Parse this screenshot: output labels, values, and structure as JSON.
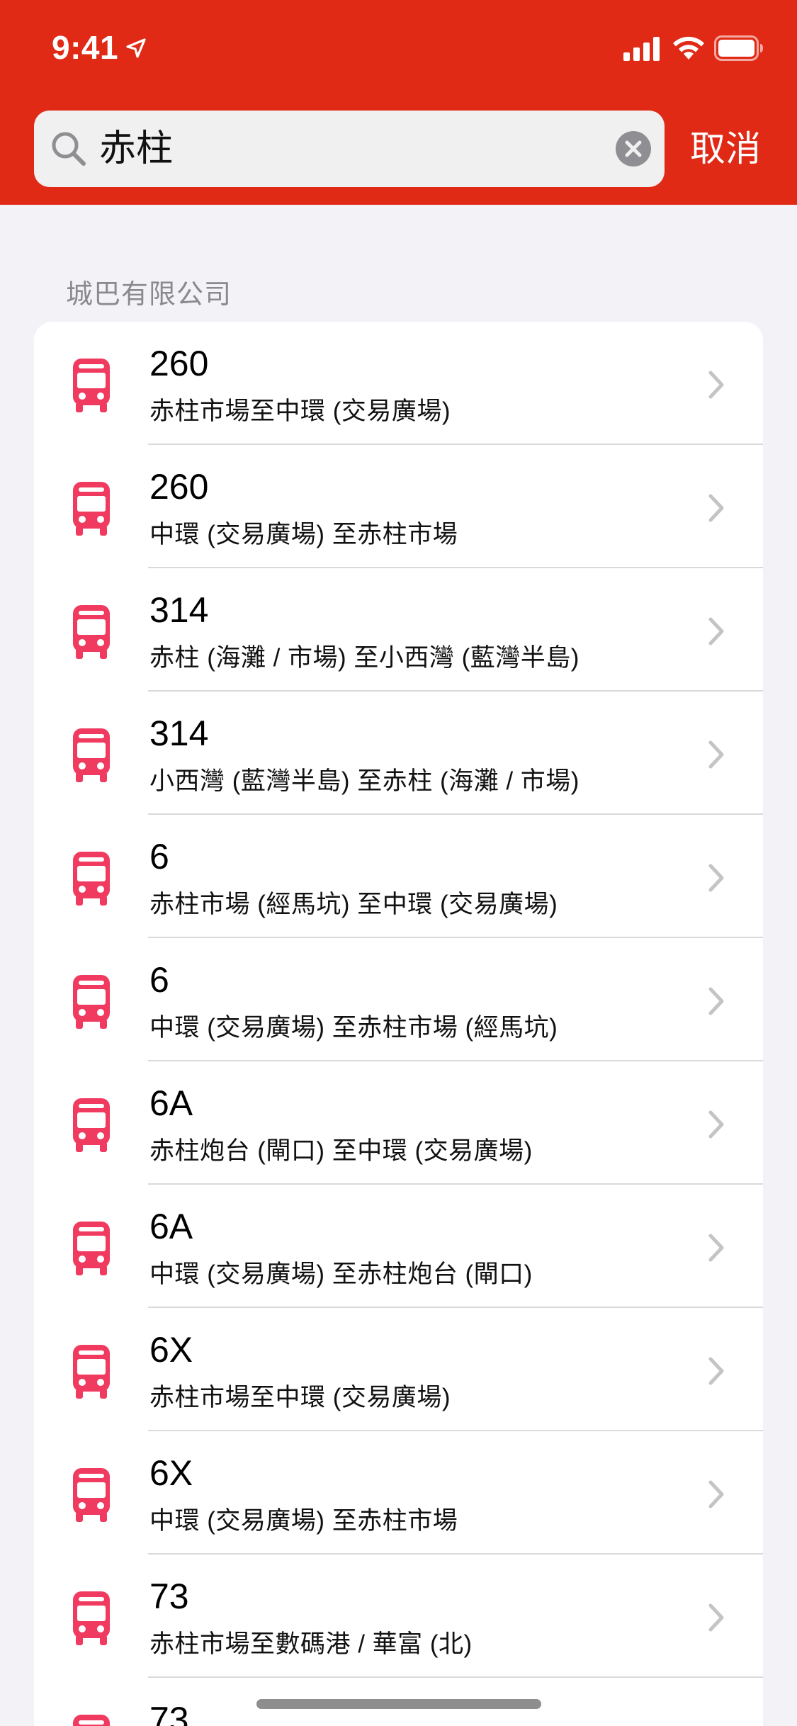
{
  "status_bar": {
    "time": "9:41",
    "icons": [
      "location-arrow-icon",
      "cellular-signal-icon",
      "wifi-icon",
      "battery-icon"
    ]
  },
  "search": {
    "value": "赤柱",
    "icon": "search-icon",
    "clear_icon": "clear-circle-icon",
    "cancel_label": "取消"
  },
  "colors": {
    "header_bg": "#e02a16",
    "bus_icon": "#f03a5f",
    "background": "#f2f2f7"
  },
  "results": {
    "section_title": "城巴有限公司",
    "item_icon": "bus-icon",
    "items": [
      {
        "route": "260",
        "description": "赤柱市場至中環 (交易廣場)"
      },
      {
        "route": "260",
        "description": "中環 (交易廣場) 至赤柱市場"
      },
      {
        "route": "314",
        "description": "赤柱 (海灘 / 市場) 至小西灣 (藍灣半島)"
      },
      {
        "route": "314",
        "description": "小西灣 (藍灣半島) 至赤柱 (海灘 / 市場)"
      },
      {
        "route": "6",
        "description": "赤柱市場 (經馬坑) 至中環 (交易廣場)"
      },
      {
        "route": "6",
        "description": "中環 (交易廣場) 至赤柱市場 (經馬坑)"
      },
      {
        "route": "6A",
        "description": "赤柱炮台 (閘口) 至中環 (交易廣場)"
      },
      {
        "route": "6A",
        "description": "中環 (交易廣場) 至赤柱炮台 (閘口)"
      },
      {
        "route": "6X",
        "description": "赤柱市場至中環 (交易廣場)"
      },
      {
        "route": "6X",
        "description": "中環 (交易廣場) 至赤柱市場"
      },
      {
        "route": "73",
        "description": "赤柱市場至數碼港 / 華富 (北)"
      },
      {
        "route": "73",
        "description": ""
      }
    ]
  }
}
